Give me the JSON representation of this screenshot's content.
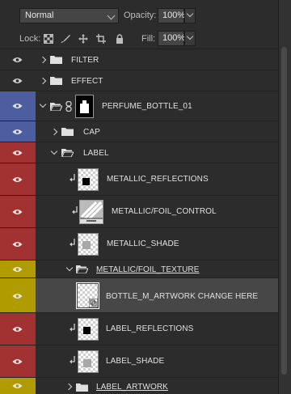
{
  "blend_mode": {
    "value": "Normal"
  },
  "opacity": {
    "label": "Opacity:",
    "value": "100%"
  },
  "lock": {
    "label": "Lock:"
  },
  "fill": {
    "label": "Fill:",
    "value": "100%"
  },
  "layers": [
    {
      "name": "FILTER",
      "type": "group",
      "expanded": false,
      "visibility_color": "none"
    },
    {
      "name": "EFFECT",
      "type": "group",
      "expanded": false,
      "visibility_color": "none"
    },
    {
      "name": "PERFUME_BOTTLE_01",
      "type": "group",
      "expanded": true,
      "visibility_color": "blue",
      "has_mask": true
    },
    {
      "name": "CAP",
      "type": "group",
      "expanded": false,
      "visibility_color": "blue"
    },
    {
      "name": "LABEL",
      "type": "group",
      "expanded": true,
      "visibility_color": "red"
    },
    {
      "name": "METALLIC_REFLECTIONS",
      "type": "layer",
      "clipped": true,
      "visibility_color": "red"
    },
    {
      "name": "METALLIC/FOIL_CONTROL",
      "type": "adjustment",
      "clipped": true,
      "visibility_color": "red"
    },
    {
      "name": "METALLIC_SHADE",
      "type": "layer",
      "clipped": true,
      "visibility_color": "red"
    },
    {
      "name": "METALLIC/FOIL_TEXTURE",
      "type": "group",
      "expanded": true,
      "visibility_color": "yellow"
    },
    {
      "name": "BOTTLE_M_ARTWORK CHANGE HERE",
      "type": "smart-object",
      "visibility_color": "yellow",
      "selected": true
    },
    {
      "name": "LABEL_REFLECTIONS",
      "type": "layer",
      "clipped": true,
      "visibility_color": "red"
    },
    {
      "name": "LABEL_SHADE",
      "type": "layer",
      "clipped": true,
      "visibility_color": "red"
    },
    {
      "name": "LABEL_ARTWORK",
      "type": "group",
      "expanded": false,
      "visibility_color": "yellow"
    }
  ]
}
